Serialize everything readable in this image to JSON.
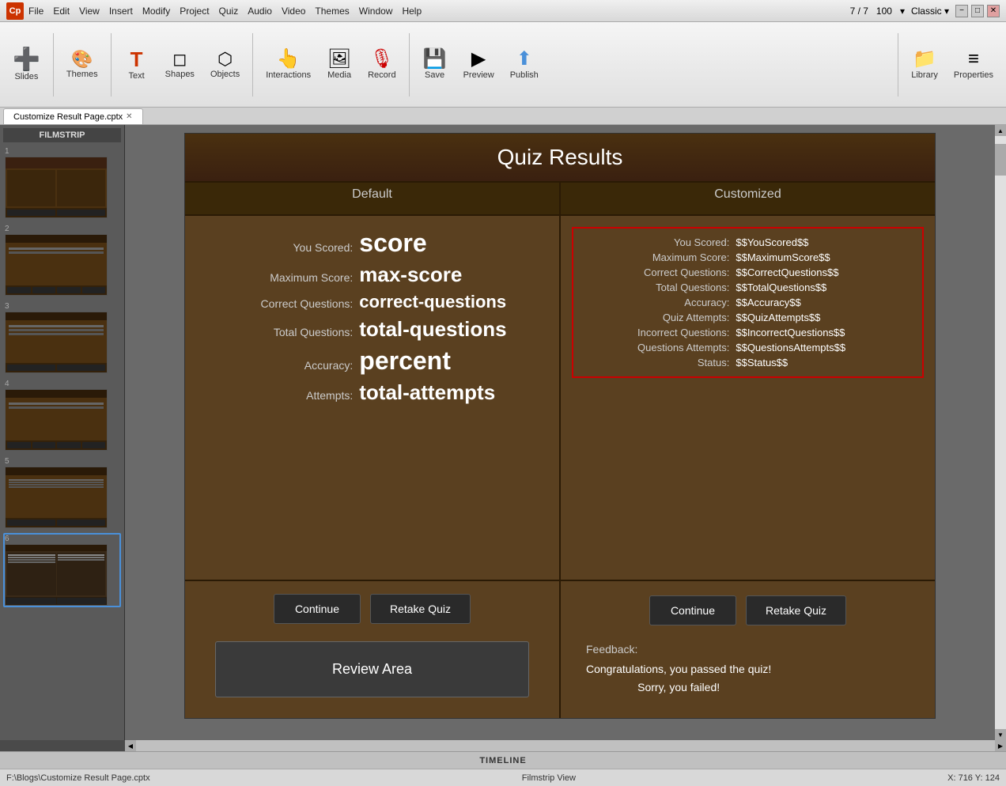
{
  "titlebar": {
    "logo": "Cp",
    "menus": [
      "File",
      "Edit",
      "View",
      "Insert",
      "Modify",
      "Project",
      "Quiz",
      "Audio",
      "Video",
      "Themes",
      "Window",
      "Help"
    ],
    "slide_num": "7",
    "slide_total": "7",
    "zoom": "100",
    "theme": "Classic",
    "buttons": [
      "−",
      "□",
      "✕"
    ]
  },
  "toolbar": {
    "items": [
      {
        "label": "Slides",
        "icon": "➕"
      },
      {
        "label": "Themes",
        "icon": "🎨"
      },
      {
        "label": "Text",
        "icon": "T"
      },
      {
        "label": "Shapes",
        "icon": "◻"
      },
      {
        "label": "Objects",
        "icon": "⬡"
      },
      {
        "label": "Interactions",
        "icon": "👆"
      },
      {
        "label": "Media",
        "icon": "🖼"
      },
      {
        "label": "Record",
        "icon": "🎙"
      },
      {
        "label": "Save",
        "icon": "💾"
      },
      {
        "label": "Preview",
        "icon": "▶"
      },
      {
        "label": "Publish",
        "icon": "⬆"
      },
      {
        "label": "Library",
        "icon": "📁"
      },
      {
        "label": "Properties",
        "icon": "≡"
      }
    ]
  },
  "tabs": {
    "items": [
      {
        "label": "Customize Result Page.cptx",
        "active": true,
        "closeable": true
      }
    ]
  },
  "filmstrip": {
    "header": "FILMSTRIP",
    "slides": [
      1,
      2,
      3,
      4,
      5,
      6
    ]
  },
  "slide": {
    "title": "Quiz Results",
    "default_header": "Default",
    "customized_header": "Customized",
    "default_rows": [
      {
        "label": "You Scored:",
        "value": "score",
        "size": "xlarge"
      },
      {
        "label": "Maximum Score:",
        "value": "max-score",
        "size": "large"
      },
      {
        "label": "Correct Questions:",
        "value": "correct-questions",
        "size": "normal"
      },
      {
        "label": "Total Questions:",
        "value": "total-questions",
        "size": "large"
      },
      {
        "label": "Accuracy:",
        "value": "percent",
        "size": "xlarge"
      },
      {
        "label": "Attempts:",
        "value": "total-attempts",
        "size": "large"
      }
    ],
    "custom_rows": [
      {
        "label": "You Scored:",
        "value": "$$YouScored$$"
      },
      {
        "label": "Maximum Score:",
        "value": "$$MaximumScore$$"
      },
      {
        "label": "Correct Questions:",
        "value": "$$CorrectQuestions$$"
      },
      {
        "label": "Total Questions:",
        "value": "$$TotalQuestions$$"
      },
      {
        "label": "Accuracy:",
        "value": "$$Accuracy$$"
      },
      {
        "label": "Quiz Attempts:",
        "value": "$$QuizAttempts$$"
      },
      {
        "label": "Incorrect Questions:",
        "value": "$$IncorrectQuestions$$"
      },
      {
        "label": "Questions Attempts:",
        "value": "$$QuestionsAttempts$$"
      },
      {
        "label": "Status:",
        "value": "$$Status$$"
      }
    ],
    "left_buttons": [
      "Continue",
      "Retake Quiz"
    ],
    "right_buttons": [
      "Continue",
      "Retake Quiz"
    ],
    "review_area": "Review Area",
    "feedback_label": "Feedback:",
    "feedback_lines": [
      "Congratulations, you passed the quiz!",
      "Sorry, you failed!"
    ]
  },
  "timeline": {
    "label": "TIMELINE"
  },
  "statusbar": {
    "file_path": "F:\\Blogs\\Customize Result Page.cptx",
    "view": "Filmstrip View",
    "coordinates": "X: 716 Y: 124"
  }
}
